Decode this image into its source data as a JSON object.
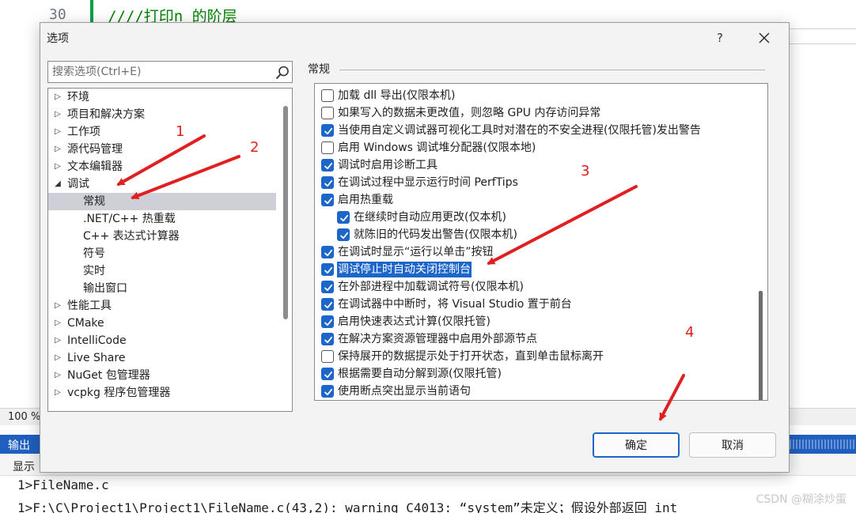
{
  "background": {
    "line_number": "30",
    "code_line": "////打印n 的阶层",
    "zoom": "100 %",
    "output_title": "输出",
    "output_show_label": "显示",
    "output_lines": [
      "1>FileName.c",
      "1>F:\\C\\Project1\\Project1\\FileName.c(43,2): warning C4013: “system”未定义；假设外部返回 int"
    ],
    "watermark": "CSDN @糊涂炒蛋"
  },
  "dialog": {
    "title": "选项",
    "help_label": "?",
    "search_placeholder": "搜索选项(Ctrl+E)",
    "tree": [
      {
        "label": "环境",
        "level": 0,
        "arrow": "▷"
      },
      {
        "label": "项目和解决方案",
        "level": 0,
        "arrow": "▷"
      },
      {
        "label": "工作项",
        "level": 0,
        "arrow": "▷"
      },
      {
        "label": "源代码管理",
        "level": 0,
        "arrow": "▷"
      },
      {
        "label": "文本编辑器",
        "level": 0,
        "arrow": "▷"
      },
      {
        "label": "调试",
        "level": 0,
        "arrow": "◢"
      },
      {
        "label": "常规",
        "level": 1,
        "arrow": "",
        "selected": true
      },
      {
        "label": ".NET/C++ 热重载",
        "level": 1,
        "arrow": ""
      },
      {
        "label": "C++ 表达式计算器",
        "level": 1,
        "arrow": ""
      },
      {
        "label": "符号",
        "level": 1,
        "arrow": ""
      },
      {
        "label": "实时",
        "level": 1,
        "arrow": ""
      },
      {
        "label": "输出窗口",
        "level": 1,
        "arrow": ""
      },
      {
        "label": "性能工具",
        "level": 0,
        "arrow": "▷"
      },
      {
        "label": "CMake",
        "level": 0,
        "arrow": "▷"
      },
      {
        "label": "IntelliCode",
        "level": 0,
        "arrow": "▷"
      },
      {
        "label": "Live Share",
        "level": 0,
        "arrow": "▷"
      },
      {
        "label": "NuGet 包管理器",
        "level": 0,
        "arrow": "▷"
      },
      {
        "label": "vcpkg 程序包管理器",
        "level": 0,
        "arrow": "▷"
      }
    ],
    "section_title": "常规",
    "options": [
      {
        "label": "加载 dll 导出(仅限本机)",
        "checked": false,
        "indent": 0
      },
      {
        "label": "如果写入的数据未更改值，则忽略 GPU 内存访问异常",
        "checked": false,
        "indent": 0
      },
      {
        "label": "当使用自定义调试器可视化工具时对潜在的不安全进程(仅限托管)发出警告",
        "checked": true,
        "indent": 0
      },
      {
        "label": "启用 Windows 调试堆分配器(仅限本地)",
        "checked": false,
        "indent": 0
      },
      {
        "label": "调试时启用诊断工具",
        "checked": true,
        "indent": 0
      },
      {
        "label": "在调试过程中显示运行时间 PerfTips",
        "checked": true,
        "indent": 0
      },
      {
        "label": "启用热重载",
        "checked": true,
        "indent": 0
      },
      {
        "label": "在继续时自动应用更改(仅本机)",
        "checked": true,
        "indent": 1
      },
      {
        "label": "就陈旧的代码发出警告(仅限本机)",
        "checked": true,
        "indent": 1
      },
      {
        "label": "在调试时显示“运行以单击”按钮",
        "checked": true,
        "indent": 0
      },
      {
        "label": "调试停止时自动关闭控制台",
        "checked": true,
        "indent": 0,
        "highlight": true
      },
      {
        "label": "在外部进程中加载调试符号(仅限本机)",
        "checked": true,
        "indent": 0
      },
      {
        "label": "在调试器中中断时，将 Visual Studio 置于前台",
        "checked": true,
        "indent": 0
      },
      {
        "label": "启用快速表达式计算(仅限托管)",
        "checked": true,
        "indent": 0
      },
      {
        "label": "在解决方案资源管理器中启用外部源节点",
        "checked": true,
        "indent": 0
      },
      {
        "label": "保持展开的数据提示处于打开状态，直到单击鼠标离开",
        "checked": false,
        "indent": 0
      },
      {
        "label": "根据需要自动分解到源(仅限托管)",
        "checked": true,
        "indent": 0
      },
      {
        "label": "使用断点突出显示当前语句",
        "checked": true,
        "indent": 0
      }
    ],
    "ok_label": "确定",
    "cancel_label": "取消"
  },
  "annotations": {
    "labels": [
      "1",
      "2",
      "3",
      "4"
    ],
    "color": "#e02020"
  },
  "colors": {
    "accent": "#1d66c9",
    "selection": "#cfcfd8",
    "output_header": "#1f5fbf"
  }
}
